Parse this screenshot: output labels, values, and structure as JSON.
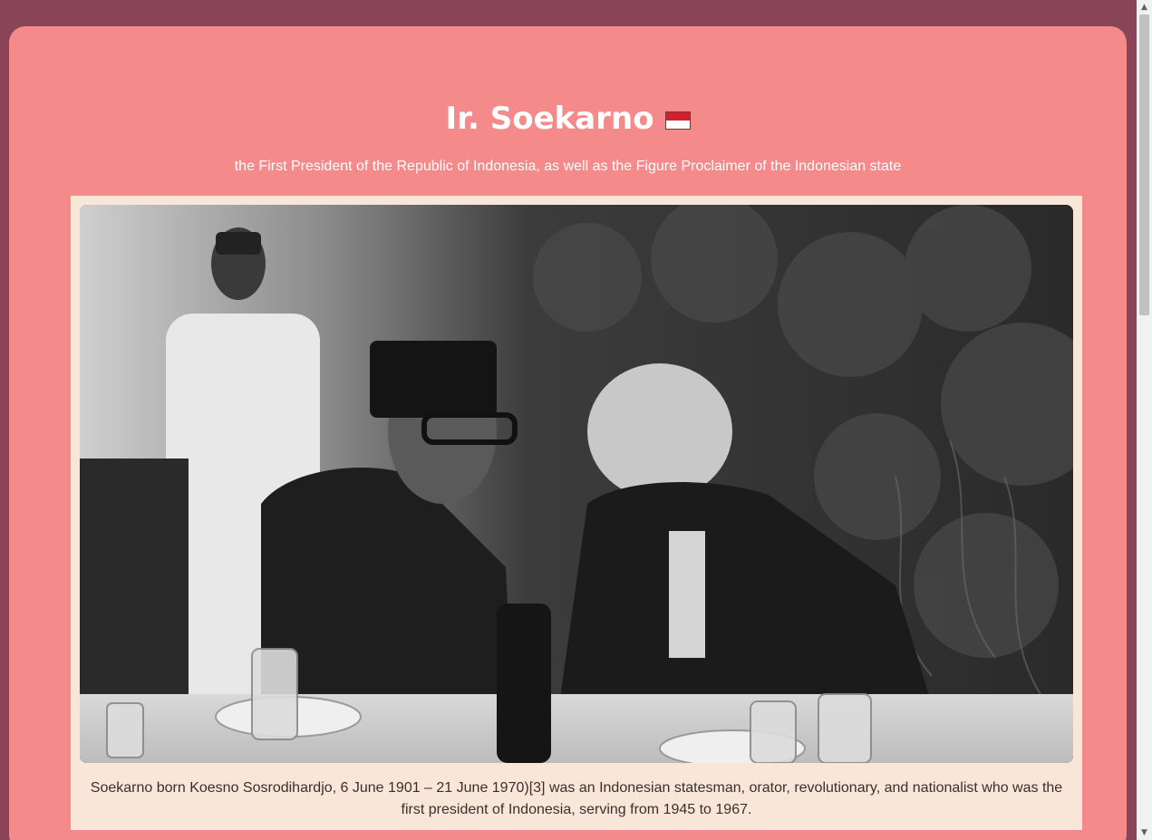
{
  "header": {
    "title": "Ir. Soekarno",
    "flag_icon": "indonesia-flag-icon",
    "subtitle": "the First President of the Republic of Indonesia, as well as the Figure Proclaimer of the Indonesian state"
  },
  "figure": {
    "caption": "Soekarno born Koesno Sosrodihardjo, 6 June 1901 – 21 June 1970)[3] was an Indonesian statesman, orator, revolutionary, and nationalist who was the first president of Indonesia, serving from 1945 to 1967."
  },
  "colors": {
    "page_background": "#8a4458",
    "card_background": "#f48a89",
    "figure_background": "#f8e6d8",
    "flag_red": "#d32030",
    "flag_white": "#ffffff"
  }
}
